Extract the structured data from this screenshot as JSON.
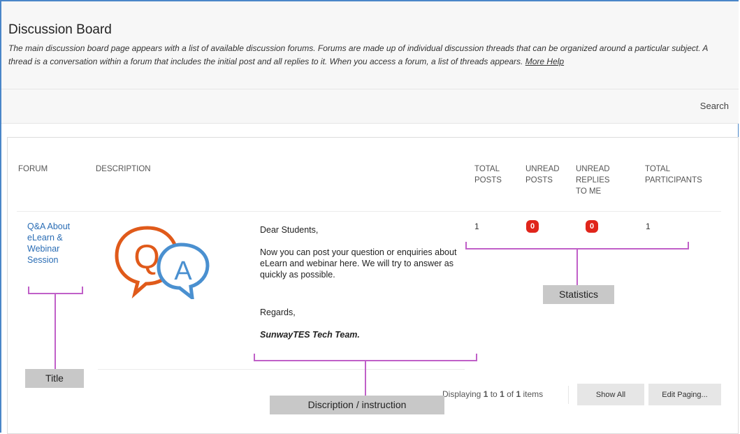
{
  "page": {
    "title": "Discussion Board",
    "intro": "The main discussion board page appears with a list of available discussion forums. Forums are made up of individual discussion threads that can be organized around a particular subject. A thread is a conversation within a forum that includes the initial post and all replies to it. When you access a forum, a list of threads appears.",
    "more_help": "More Help"
  },
  "search": {
    "label": "Search"
  },
  "table": {
    "columns": {
      "forum": "FORUM",
      "description": "DESCRIPTION",
      "total_posts_1": "TOTAL",
      "total_posts_2": "POSTS",
      "unread_posts_1": "UNREAD",
      "unread_posts_2": "POSTS",
      "unread_replies_1": "UNREAD",
      "unread_replies_2": "REPLIES",
      "unread_replies_3": "TO ME",
      "participants_1": "TOTAL",
      "participants_2": "PARTICIPANTS"
    },
    "row": {
      "forum_line1": "Q&A About",
      "forum_line2": "eLearn &",
      "forum_line3": "Webinar",
      "forum_line4": "Session",
      "logo_q": "Q",
      "logo_a": "A",
      "desc_greeting": "Dear Students,",
      "desc_body": "Now you can post your question or enquiries about eLearn and webinar here. We will try to answer as quickly as possible.",
      "desc_regards": "Regards,",
      "desc_sign": "SunwayTES Tech Team.",
      "total_posts": "1",
      "unread_posts": "0",
      "unread_replies": "0",
      "total_participants": "1"
    }
  },
  "paging": {
    "prefix": "Displaying ",
    "from": "1",
    "to_word": " to ",
    "to": "1",
    "of_word": " of ",
    "total": "1",
    "suffix": " items",
    "show_all": "Show All",
    "edit_paging": "Edit Paging..."
  },
  "annotations": {
    "title": "Title",
    "description": "Discription / instruction",
    "statistics": "Statistics"
  },
  "colors": {
    "accent": "#4a86c8",
    "link": "#2a6db5",
    "badge": "#e0251b",
    "annotation_line": "#c060c8",
    "q_bubble": "#e05a1a",
    "a_bubble": "#4a90d0"
  }
}
